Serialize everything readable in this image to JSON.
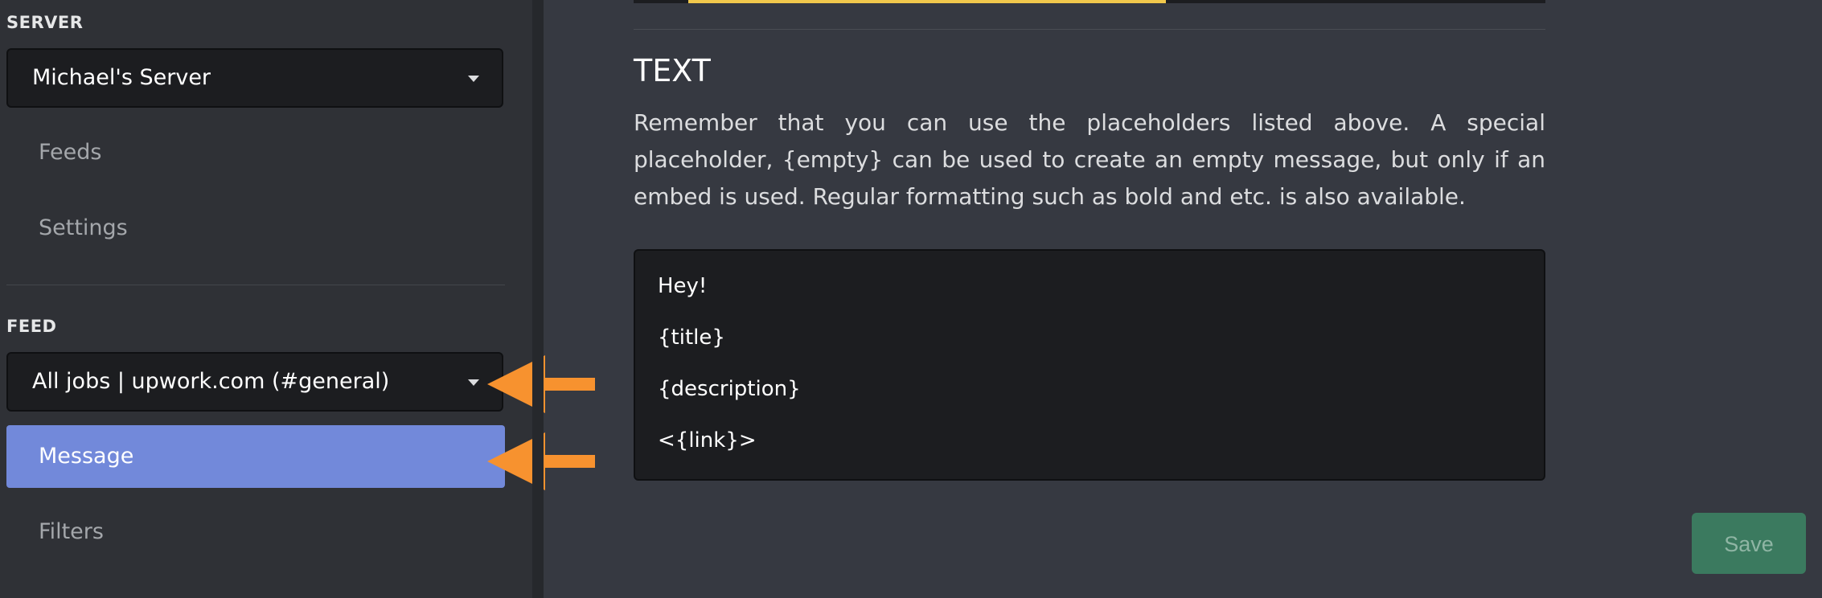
{
  "sidebar": {
    "server_header": "SERVER",
    "server_select": {
      "value": "Michael's Server"
    },
    "server_nav": [
      {
        "label": "Feeds"
      },
      {
        "label": "Settings"
      }
    ],
    "feed_header": "FEED",
    "feed_select": {
      "value": "All jobs | upwork.com (#general)"
    },
    "feed_nav": [
      {
        "label": "Message",
        "active": true
      },
      {
        "label": "Filters"
      }
    ]
  },
  "annotations": {
    "arrow_color": "#f7922f",
    "arrows": [
      "arrow-icon",
      "arrow-icon"
    ]
  },
  "main": {
    "heading": "TEXT",
    "description": "Remember that you can use the placeholders listed above. A special placeholder, {empty} can be used to create an empty message, but only if an embed is used. Regular formatting such as bold and etc. is also available.",
    "message_lines": [
      "Hey!",
      "{title}",
      "{description}",
      "<{link}>"
    ],
    "save_label": "Save"
  },
  "colors": {
    "accent": "#7289da",
    "save": "#3b7a5f",
    "highlight": "#f1c84c"
  }
}
